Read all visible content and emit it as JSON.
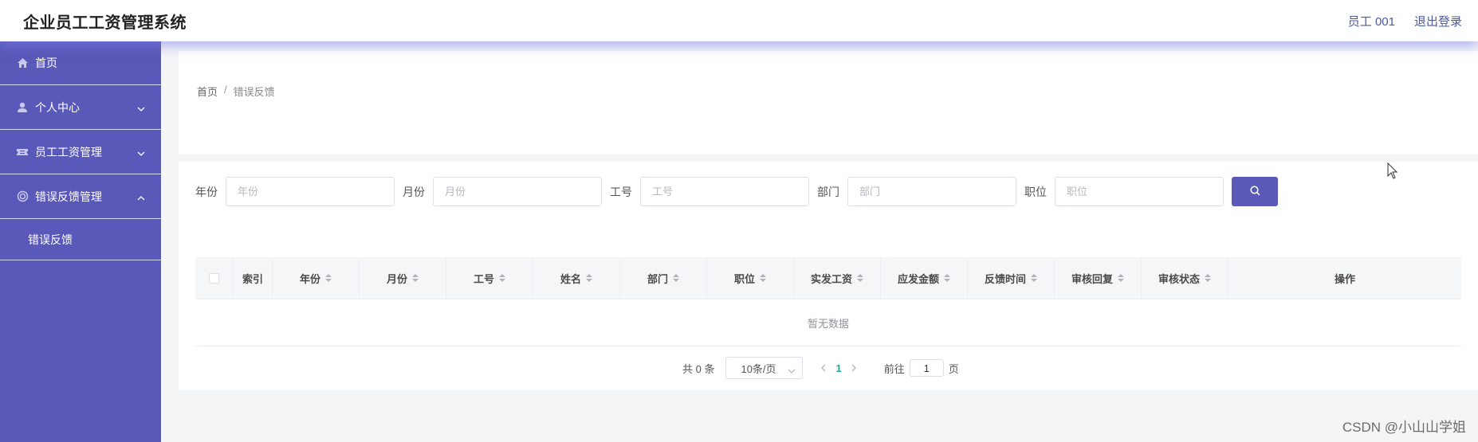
{
  "header": {
    "title": "企业员工工资管理系统",
    "user": "员工 001",
    "logout": "退出登录"
  },
  "sidebar": {
    "items": [
      {
        "label": "首页",
        "icon": "home-icon"
      },
      {
        "label": "个人中心",
        "icon": "user-icon"
      },
      {
        "label": "员工工资管理",
        "icon": "ticket-icon"
      },
      {
        "label": "错误反馈管理",
        "icon": "settings-icon"
      }
    ],
    "sub_items": [
      {
        "label": "错误反馈"
      }
    ]
  },
  "breadcrumb": {
    "home": "首页",
    "separator": "/",
    "current": "错误反馈"
  },
  "filters": [
    {
      "label": "年份",
      "placeholder": "年份"
    },
    {
      "label": "月份",
      "placeholder": "月份"
    },
    {
      "label": "工号",
      "placeholder": "工号"
    },
    {
      "label": "部门",
      "placeholder": "部门"
    },
    {
      "label": "职位",
      "placeholder": "职位"
    }
  ],
  "table": {
    "columns": [
      "索引",
      "年份",
      "月份",
      "工号",
      "姓名",
      "部门",
      "职位",
      "实发工资",
      "应发金额",
      "反馈时间",
      "审核回复",
      "审核状态",
      "操作"
    ],
    "empty_text": "暂无数据"
  },
  "pagination": {
    "total": "共 0 条",
    "page_size": "10条/页",
    "current_page": "1",
    "goto_prefix": "前往",
    "goto_value": "1",
    "goto_suffix": "页"
  },
  "watermark": "CSDN @小山山学姐",
  "colors": {
    "accent": "#5a58b8",
    "active_page": "#26a69a"
  }
}
